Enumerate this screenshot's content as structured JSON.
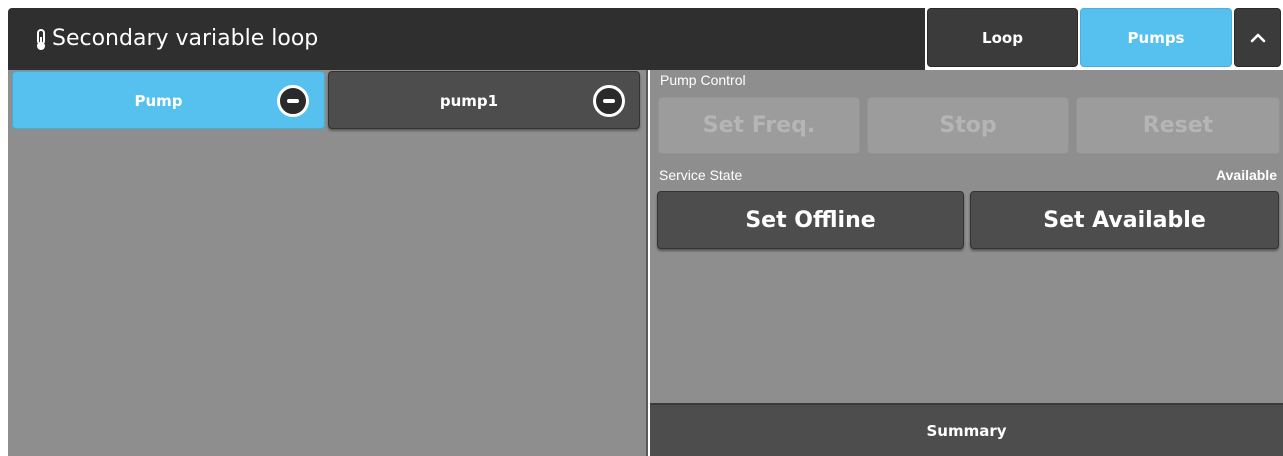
{
  "header": {
    "title": "Secondary variable loop",
    "icon": "thermometer-icon",
    "tabs": [
      {
        "label": "Loop",
        "active": false
      },
      {
        "label": "Pumps",
        "active": true
      }
    ],
    "collapse_icon": "chevron-up-icon"
  },
  "pumps": {
    "tabs": [
      {
        "label": "Pump",
        "active": true
      },
      {
        "label": "pump1",
        "active": false
      }
    ]
  },
  "pump_control": {
    "label": "Pump Control",
    "buttons": [
      "Set Freq.",
      "Stop",
      "Reset"
    ]
  },
  "service_state": {
    "label": "Service State",
    "value": "Available",
    "buttons": [
      "Set Offline",
      "Set Available"
    ]
  },
  "footer": {
    "summary_label": "Summary"
  },
  "colors": {
    "accent": "#56c1ef",
    "header_bg": "#2f2f2f",
    "panel_bg": "#8e8e8e",
    "button_dark": "#4d4d4d",
    "button_disabled": "#9c9c9c"
  }
}
